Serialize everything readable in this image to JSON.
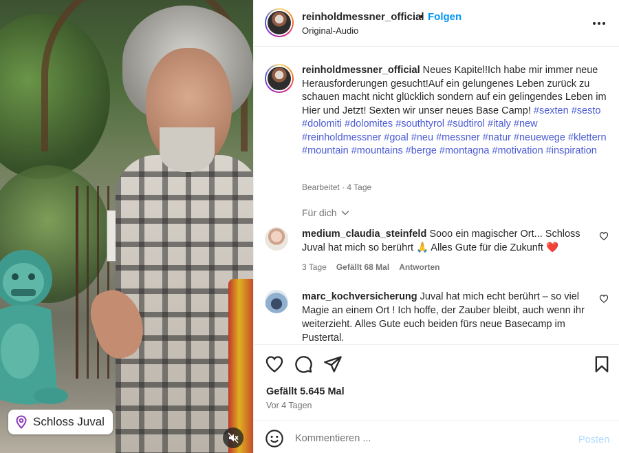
{
  "post": {
    "username": "reinholdmessner_official",
    "dot": "•",
    "follow_label": "Folgen",
    "audio": "Original-Audio",
    "location": "Schloss Juval"
  },
  "caption": {
    "username": "reinholdmessner_official",
    "text": "Neues Kapitel!Ich habe mir immer neue Herausforderungen gesucht!Auf ein gelungenes Leben zurück zu schauen macht nicht glücklich sondern auf ein gelingendes Leben im Hier und Jetzt! Sexten wir unser neues Base Camp!",
    "hashtags": "#sexten #sesto #dolomiti #dolomites #southtyrol #südtirol #italy #new #reinholdmessner #goal #neu #messner #natur #neuewege #klettern #mountain #mountains #berge #montagna #motivation #inspiration",
    "meta": "Bearbeitet · 4 Tage"
  },
  "for_you_label": "Für dich",
  "comments": [
    {
      "username": "medium_claudia_steinfeld",
      "text": "Sooo ein magischer Ort... Schloss Juval hat mich so berührt 🙏 Alles Gute für die Zukunft ❤️",
      "time": "3 Tage",
      "likes": "Gefällt 68 Mal",
      "reply": "Antworten"
    },
    {
      "username": "marc_kochversicherung",
      "text": "Juval hat mich echt berührt – so viel Magie an einem Ort ! Ich hoffe, der Zauber bleibt, auch wenn ihr weiterzieht. Alles Gute euch beiden fürs neue Basecamp im Pustertal."
    }
  ],
  "actions": {
    "likes": "Gefällt 5.645 Mal",
    "time": "Vor 4 Tagen"
  },
  "comment_box": {
    "placeholder": "Kommentieren ...",
    "post_label": "Posten"
  },
  "colors": {
    "link_blue": "#0095f6",
    "hashtag_blue": "#4a5bd5",
    "muted_text": "#737373",
    "post_disabled": "#b3dbff"
  }
}
